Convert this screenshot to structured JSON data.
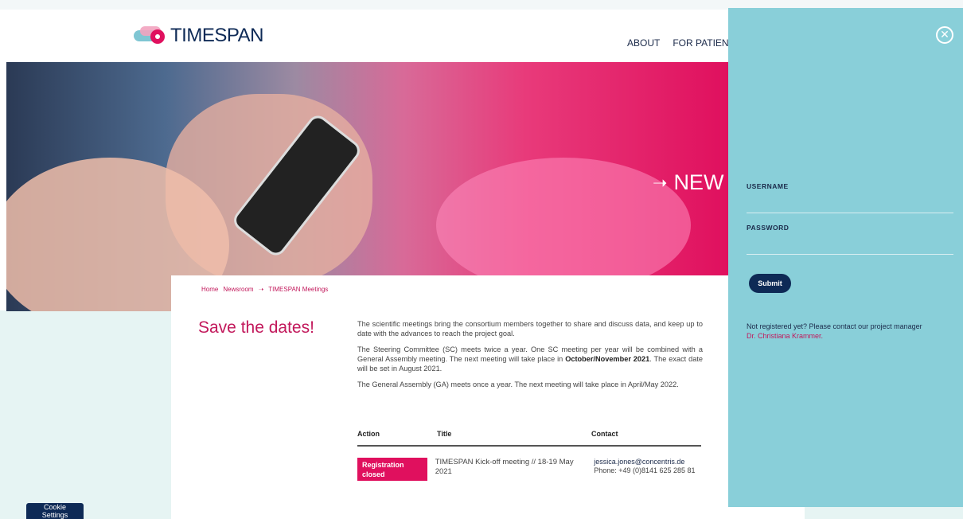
{
  "brand": {
    "name": "TIMESPAN"
  },
  "nav": {
    "items": [
      "ABOUT",
      "FOR PATIENTS & PL"
    ]
  },
  "hero": {
    "title": "NEW"
  },
  "breadcrumb": {
    "home": "Home",
    "newsroom": "Newsroom",
    "current": "TIMESPAN Meetings"
  },
  "page": {
    "heading": "Save the dates!",
    "p1": "The scientific meetings bring the consortium members together to share and discuss data, and keep up to date with the advances to reach the project goal.",
    "p2_before": "The Steering Committee (SC) meets twice a year. One SC meeting per year will be combined with a General Assembly meeting. The next meeting will take place in ",
    "p2_bold": "October/November 2021",
    "p2_after": ". The exact date will be set in August 2021.",
    "p3": "The General Assembly (GA) meets once a year. The next meeting will take place in April/May 2022."
  },
  "table": {
    "headers": {
      "action": "Action",
      "title": "Title",
      "contact": "Contact"
    },
    "rows": [
      {
        "action": "Registration closed",
        "title": "TIMESPAN Kick-off meeting // 18-19 May 2021",
        "email": "jessica.jones@concentris.de",
        "phone": "Phone: +49 (0)8141 625 285 81"
      }
    ]
  },
  "cookie": {
    "label": "Cookie Settings"
  },
  "login": {
    "username_label": "USERNAME",
    "password_label": "PASSWORD",
    "submit_label": "Submit",
    "register_text": "Not registered yet? Please contact our project manager",
    "register_link": "Dr. Christiana Krammer."
  },
  "colors": {
    "accent": "#c2185b",
    "navy": "#0e2a56",
    "panel": "#89cfd9"
  }
}
